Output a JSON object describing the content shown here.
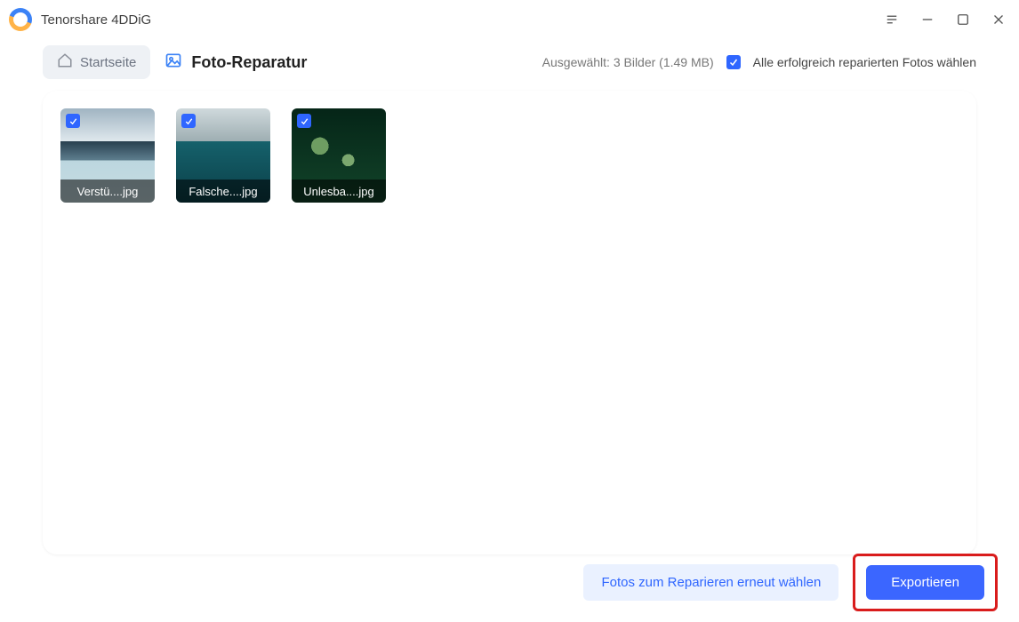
{
  "app": {
    "title": "Tenorshare 4DDiG"
  },
  "nav": {
    "home_label": "Startseite",
    "page_label": "Foto-Reparatur"
  },
  "selection": {
    "status": "Ausgewählt: 3 Bilder (1.49 MB)",
    "select_all_label": "Alle erfolgreich reparierten Fotos wählen",
    "select_all_checked": true
  },
  "thumbs": [
    {
      "filename": "Verstü....jpg",
      "checked": true
    },
    {
      "filename": "Falsche....jpg",
      "checked": true
    },
    {
      "filename": "Unlesba....jpg",
      "checked": true
    }
  ],
  "footer": {
    "choose_again_label": "Fotos zum Reparieren erneut wählen",
    "export_label": "Exportieren"
  }
}
